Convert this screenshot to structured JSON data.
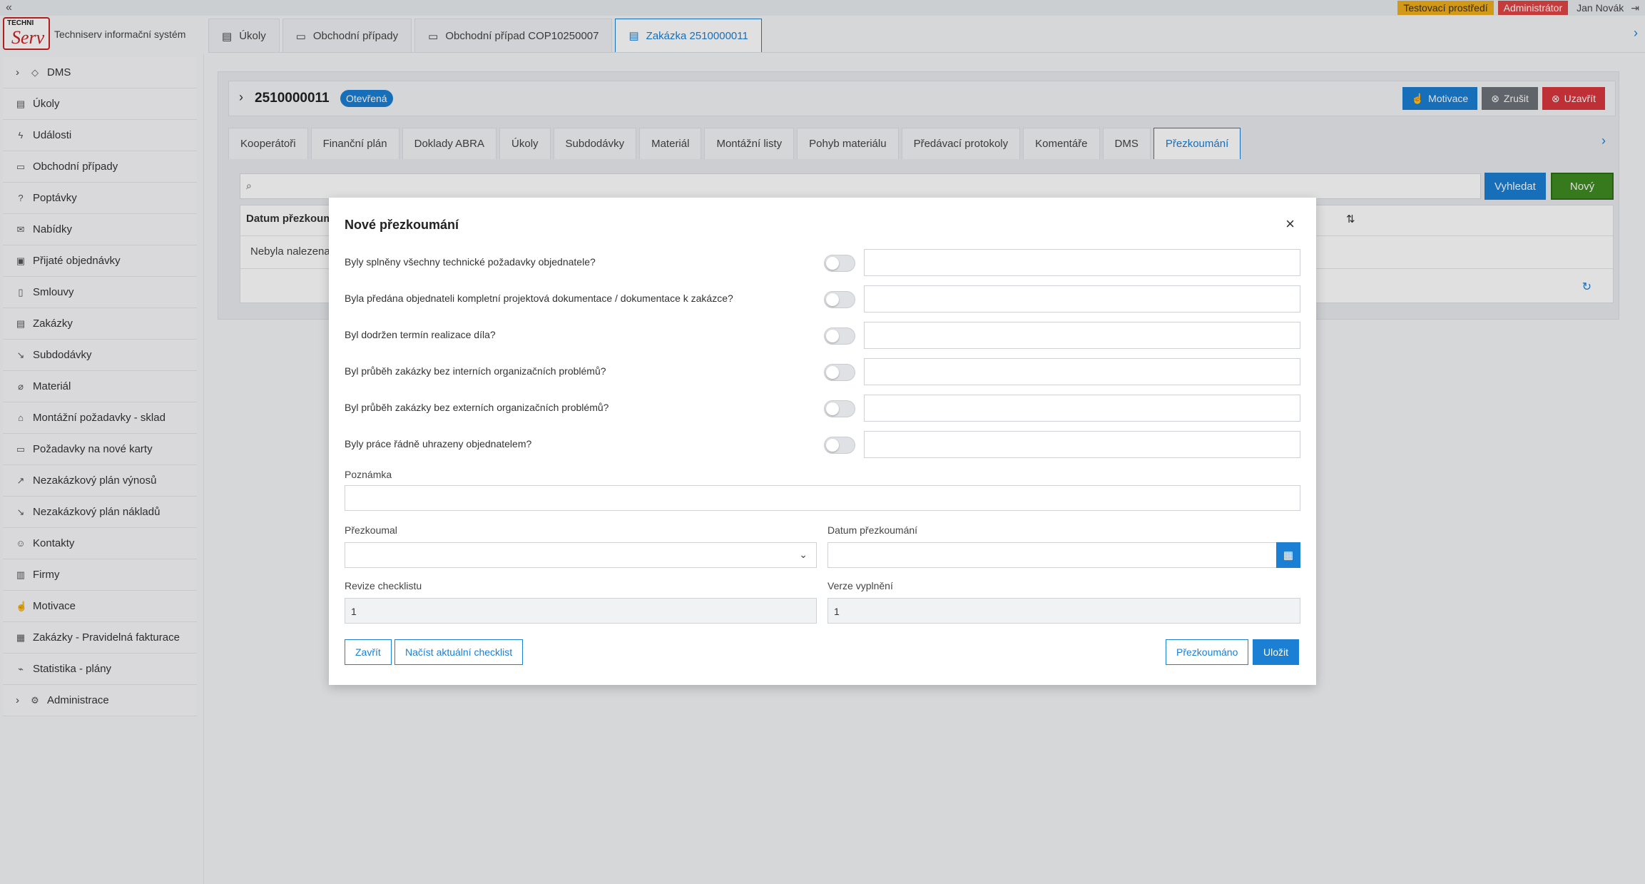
{
  "topbar": {
    "collapse_icon": "double-chevron-left",
    "env_badge": "Testovací prostředí",
    "role_badge": "Administrátor",
    "user": "Jan Novák",
    "logout_icon": "logout"
  },
  "logo": {
    "mark_top": "TECHNI",
    "mark_script": "Serv",
    "app_name": "Techniserv informační systém"
  },
  "app_tabs": [
    {
      "label": "Úkoly",
      "icon": "clipboard"
    },
    {
      "label": "Obchodní případy",
      "icon": "briefcase"
    },
    {
      "label": "Obchodní případ COP10250007",
      "icon": "briefcase"
    },
    {
      "label": "Zakázka 2510000011",
      "icon": "document",
      "active": true
    }
  ],
  "sidebar": [
    {
      "label": "DMS",
      "expandable": true
    },
    {
      "label": "Úkoly"
    },
    {
      "label": "Události"
    },
    {
      "label": "Obchodní případy"
    },
    {
      "label": "Poptávky"
    },
    {
      "label": "Nabídky"
    },
    {
      "label": "Přijaté objednávky"
    },
    {
      "label": "Smlouvy"
    },
    {
      "label": "Zakázky"
    },
    {
      "label": "Subdodávky"
    },
    {
      "label": "Materiál"
    },
    {
      "label": "Montážní požadavky - sklad"
    },
    {
      "label": "Požadavky na nové karty"
    },
    {
      "label": "Nezakázkový plán výnosů"
    },
    {
      "label": "Nezakázkový plán nákladů"
    },
    {
      "label": "Kontakty"
    },
    {
      "label": "Firmy"
    },
    {
      "label": "Motivace"
    },
    {
      "label": "Zakázky - Pravidelná fakturace"
    },
    {
      "label": "Statistika - plány"
    },
    {
      "label": "Administrace",
      "expandable": true
    }
  ],
  "detail": {
    "number": "2510000011",
    "status": "Otevřená",
    "buttons": {
      "motivace": "Motivace",
      "zrusit": "Zrušit",
      "uzavrit": "Uzavřít"
    },
    "tabs": [
      "Kooperátoři",
      "Finanční plán",
      "Doklady ABRA",
      "Úkoly",
      "Subdodávky",
      "Materiál",
      "Montážní listy",
      "Pohyb materiálu",
      "Předávací protokoly",
      "Komentáře",
      "DMS",
      "Přezkoumání"
    ],
    "active_tab": "Přezkoumání",
    "search_button": "Vyhledat",
    "new_button": "Nový",
    "table_header": "Datum přezkoumá",
    "table_empty": "Nebyla nalezena ž"
  },
  "modal": {
    "title": "Nové přezkoumání",
    "questions": [
      {
        "label": "Byly splněny všechny technické požadavky objednatele?",
        "checked": false,
        "value": ""
      },
      {
        "label": "Byla předána objednateli kompletní projektová dokumentace / dokumentace k zakázce?",
        "checked": false,
        "value": ""
      },
      {
        "label": "Byl dodržen termín realizace díla?",
        "checked": false,
        "value": ""
      },
      {
        "label": "Byl průběh zakázky bez interních organizačních problémů?",
        "checked": false,
        "value": ""
      },
      {
        "label": "Byl průběh zakázky bez externích organizačních problémů?",
        "checked": false,
        "value": ""
      },
      {
        "label": "Byly práce řádně uhrazeny objednatelem?",
        "checked": false,
        "value": ""
      }
    ],
    "note_label": "Poznámka",
    "note_value": "",
    "reviewer_label": "Přezkoumal",
    "reviewer_value": "",
    "date_label": "Datum přezkoumání",
    "date_value": "",
    "revision_label": "Revize checklistu",
    "revision_value": "1",
    "version_label": "Verze vyplnění",
    "version_value": "1",
    "buttons": {
      "close": "Zavřít",
      "load": "Načíst aktuální checklist",
      "reviewed": "Přezkoumáno",
      "save": "Uložit"
    }
  }
}
